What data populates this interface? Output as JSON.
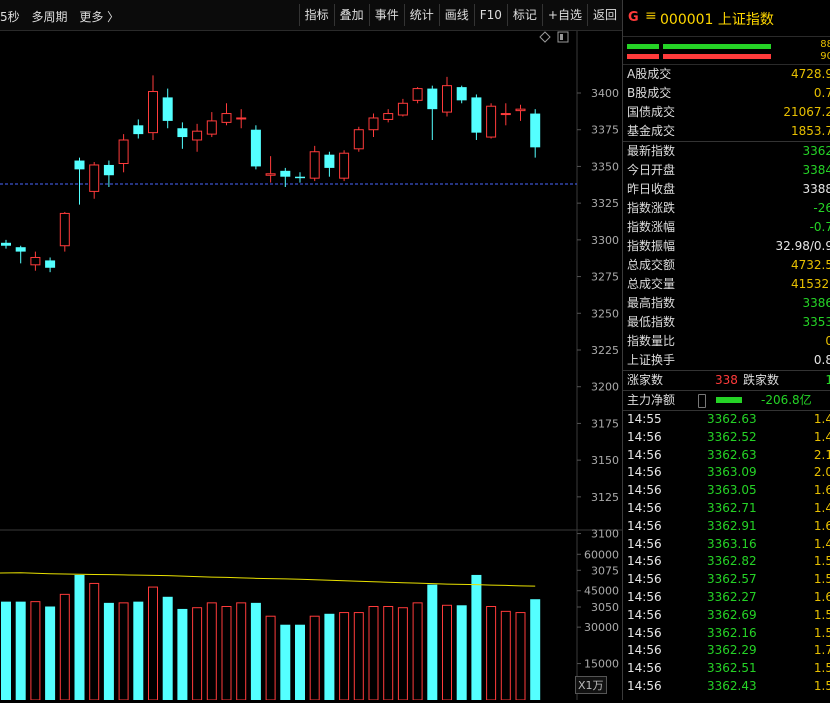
{
  "toolbar": {
    "left_items": [
      "5秒",
      "多周期",
      "更多 〉"
    ],
    "buttons": [
      "指标",
      "叠加",
      "事件",
      "统计",
      "画线",
      "F10",
      "标记",
      "+自选",
      "返回"
    ]
  },
  "chart": {
    "price_ticks": [
      "3400",
      "3375",
      "3350",
      "3325",
      "3300",
      "3275",
      "3250",
      "3225",
      "3200",
      "3175",
      "3150",
      "3125",
      "3100",
      "3075",
      "3050"
    ],
    "volume_ticks": [
      "60000",
      "45000",
      "30000",
      "15000"
    ],
    "volume_unit": "X1万",
    "reference_price": 3338,
    "colors": {
      "up": "#ff3b3b",
      "down": "#54ffff",
      "ma": "#e8e000",
      "ref": "#4a66ff"
    }
  },
  "chart_data": {
    "type": "candlestick",
    "price_ylim": [
      3030,
      3420
    ],
    "volume_ylim": [
      0,
      70000
    ],
    "candles": [
      {
        "o": 3298,
        "c": 3296,
        "h": 3300,
        "l": 3294
      },
      {
        "o": 3295,
        "c": 3292,
        "h": 3296,
        "l": 3284
      },
      {
        "o": 3283,
        "c": 3288,
        "h": 3292,
        "l": 3279
      },
      {
        "o": 3286,
        "c": 3281,
        "h": 3288,
        "l": 3278
      },
      {
        "o": 3296,
        "c": 3318,
        "h": 3319,
        "l": 3292
      },
      {
        "o": 3354,
        "c": 3348,
        "h": 3356,
        "l": 3324
      },
      {
        "o": 3333,
        "c": 3351,
        "h": 3353,
        "l": 3328
      },
      {
        "o": 3351,
        "c": 3344,
        "h": 3354,
        "l": 3336
      },
      {
        "o": 3352,
        "c": 3368,
        "h": 3372,
        "l": 3346
      },
      {
        "o": 3378,
        "c": 3372,
        "h": 3382,
        "l": 3369
      },
      {
        "o": 3373,
        "c": 3401,
        "h": 3412,
        "l": 3368
      },
      {
        "o": 3397,
        "c": 3381,
        "h": 3403,
        "l": 3376
      },
      {
        "o": 3376,
        "c": 3370,
        "h": 3380,
        "l": 3362
      },
      {
        "o": 3368,
        "c": 3374,
        "h": 3379,
        "l": 3360
      },
      {
        "o": 3372,
        "c": 3381,
        "h": 3387,
        "l": 3370
      },
      {
        "o": 3380,
        "c": 3386,
        "h": 3393,
        "l": 3378
      },
      {
        "o": 3383,
        "c": 3383,
        "h": 3389,
        "l": 3376
      },
      {
        "o": 3375,
        "c": 3350,
        "h": 3378,
        "l": 3348
      },
      {
        "o": 3344,
        "c": 3345,
        "h": 3357,
        "l": 3339
      },
      {
        "o": 3347,
        "c": 3343,
        "h": 3349,
        "l": 3336
      },
      {
        "o": 3343,
        "c": 3342,
        "h": 3346,
        "l": 3339
      },
      {
        "o": 3342,
        "c": 3360,
        "h": 3364,
        "l": 3340
      },
      {
        "o": 3358,
        "c": 3349,
        "h": 3360,
        "l": 3343
      },
      {
        "o": 3342,
        "c": 3359,
        "h": 3361,
        "l": 3340
      },
      {
        "o": 3362,
        "c": 3375,
        "h": 3377,
        "l": 3360
      },
      {
        "o": 3375,
        "c": 3383,
        "h": 3386,
        "l": 3370
      },
      {
        "o": 3382,
        "c": 3386,
        "h": 3389,
        "l": 3380
      },
      {
        "o": 3385,
        "c": 3393,
        "h": 3396,
        "l": 3384
      },
      {
        "o": 3395,
        "c": 3403,
        "h": 3404,
        "l": 3393
      },
      {
        "o": 3403,
        "c": 3389,
        "h": 3405,
        "l": 3368
      },
      {
        "o": 3387,
        "c": 3405,
        "h": 3411,
        "l": 3384
      },
      {
        "o": 3404,
        "c": 3395,
        "h": 3405,
        "l": 3393
      },
      {
        "o": 3397,
        "c": 3373,
        "h": 3399,
        "l": 3368
      },
      {
        "o": 3370,
        "c": 3391,
        "h": 3393,
        "l": 3369
      },
      {
        "o": 3386,
        "c": 3386,
        "h": 3393,
        "l": 3378
      },
      {
        "o": 3388,
        "c": 3389,
        "h": 3392,
        "l": 3381
      },
      {
        "o": 3386,
        "c": 3363,
        "h": 3389,
        "l": 3356
      }
    ],
    "volumes": [
      40500,
      40500,
      40500,
      38500,
      43500,
      51500,
      48000,
      40000,
      40000,
      40500,
      46500,
      42500,
      37500,
      38000,
      40000,
      38500,
      40000,
      40000,
      34500,
      31000,
      31000,
      34500,
      35500,
      36000,
      36000,
      38500,
      38500,
      38000,
      40000,
      47500,
      39000,
      39000,
      51500,
      38500,
      36500,
      36000,
      41500
    ],
    "ma_line": [
      52300,
      52400,
      52200,
      52000,
      51900,
      51800,
      51700,
      51600,
      51500,
      51400,
      51300,
      51200,
      51000,
      50800,
      50600,
      50500,
      50300,
      50100,
      50000,
      49900,
      49700,
      49500,
      49300,
      49100,
      48900,
      48700,
      48500,
      48300,
      48100,
      47900,
      47700,
      47600,
      47500,
      47300,
      47200,
      47000,
      46900
    ]
  },
  "panel": {
    "code_mark": "G",
    "menu_glyph": "≡",
    "title": "000001 上证指数",
    "bar_nums": [
      "88",
      "90"
    ],
    "turnover": [
      {
        "label": "A股成交",
        "value": "4728.9"
      },
      {
        "label": "B股成交",
        "value": "0.7"
      },
      {
        "label": "国债成交",
        "value": "21067.2"
      },
      {
        "label": "基金成交",
        "value": "1853.7"
      }
    ],
    "stats": [
      {
        "label": "最新指数",
        "value": "3362",
        "color": "grn"
      },
      {
        "label": "今日开盘",
        "value": "3384",
        "color": "grn"
      },
      {
        "label": "昨日收盘",
        "value": "3388",
        "color": "wht"
      },
      {
        "label": "指数涨跌",
        "value": "-26",
        "color": "grn"
      },
      {
        "label": "指数涨幅",
        "value": "-0.7",
        "color": "grn"
      },
      {
        "label": "指数振幅",
        "value": "32.98/0.9",
        "color": "wht"
      },
      {
        "label": "总成交额",
        "value": "4732.5",
        "color": "yel"
      },
      {
        "label": "总成交量",
        "value": "41532.",
        "color": "yel"
      },
      {
        "label": "最高指数",
        "value": "3386",
        "color": "grn"
      },
      {
        "label": "最低指数",
        "value": "3353",
        "color": "grn"
      },
      {
        "label": "指数量比",
        "value": "0",
        "color": "yel"
      },
      {
        "label": "上证换手",
        "value": "0.8",
        "color": "wht"
      }
    ],
    "breadth": {
      "up_label": "涨家数",
      "up_value": "338",
      "down_label": "跌家数",
      "down_value": "1"
    },
    "net": {
      "label": "主力净额",
      "value": "-206.8亿"
    },
    "ticks": [
      {
        "t": "14:55",
        "p": "3362.63",
        "v": "1.4"
      },
      {
        "t": "14:56",
        "p": "3362.52",
        "v": "1.4"
      },
      {
        "t": "14:56",
        "p": "3362.63",
        "v": "2.1"
      },
      {
        "t": "14:56",
        "p": "3363.09",
        "v": "2.0"
      },
      {
        "t": "14:56",
        "p": "3363.05",
        "v": "1.6"
      },
      {
        "t": "14:56",
        "p": "3362.71",
        "v": "1.4"
      },
      {
        "t": "14:56",
        "p": "3362.91",
        "v": "1.6"
      },
      {
        "t": "14:56",
        "p": "3363.16",
        "v": "1.4"
      },
      {
        "t": "14:56",
        "p": "3362.82",
        "v": "1.5"
      },
      {
        "t": "14:56",
        "p": "3362.57",
        "v": "1.5"
      },
      {
        "t": "14:56",
        "p": "3362.27",
        "v": "1.6"
      },
      {
        "t": "14:56",
        "p": "3362.69",
        "v": "1.5"
      },
      {
        "t": "14:56",
        "p": "3362.16",
        "v": "1.5"
      },
      {
        "t": "14:56",
        "p": "3362.29",
        "v": "1.7"
      },
      {
        "t": "14:56",
        "p": "3362.51",
        "v": "1.5"
      },
      {
        "t": "14:56",
        "p": "3362.43",
        "v": "1.5"
      }
    ]
  }
}
